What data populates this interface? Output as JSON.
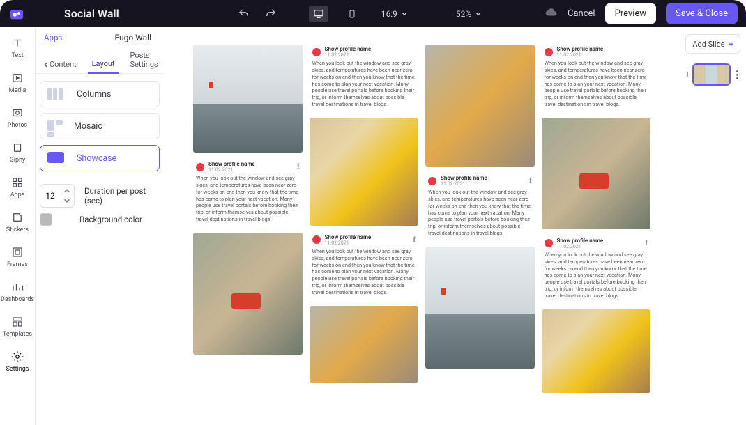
{
  "header": {
    "title": "Social Wall",
    "aspect": "16:9",
    "zoom": "52%",
    "cancel": "Cancel",
    "preview": "Preview",
    "save": "Save & Close"
  },
  "rail": {
    "items": [
      {
        "key": "text",
        "label": "Text"
      },
      {
        "key": "media",
        "label": "Media"
      },
      {
        "key": "photos",
        "label": "Photos"
      },
      {
        "key": "giphy",
        "label": "Giphy"
      },
      {
        "key": "apps",
        "label": "Apps"
      },
      {
        "key": "stickers",
        "label": "Stickers"
      },
      {
        "key": "frames",
        "label": "Frames"
      },
      {
        "key": "dashboards",
        "label": "Dashboards"
      },
      {
        "key": "templates",
        "label": "Templates"
      },
      {
        "key": "settings",
        "label": "Settings"
      }
    ]
  },
  "sidebar": {
    "apps_link": "Apps",
    "wall_name": "Fugo Wall",
    "tabs": {
      "content": "Content",
      "layout": "Layout",
      "posts": "Posts Settings"
    },
    "layout_options": {
      "columns": "Columns",
      "mosaic": "Mosaic",
      "showcase": "Showcase"
    },
    "duration_value": "12",
    "duration_label": "Duration per post (sec)",
    "bg_label": "Background color",
    "bg_color": "#b9b9b9"
  },
  "sample": {
    "profile": "Show profile name",
    "date": "11.02.2021",
    "caption": "When you look out the window and see gray skies, and temperatures have been near zero for weeks on end then you know that the time has come to plan your next vacation. Many people use travel portals before booking their trip, or inform themselves about possible travel destinations in travel blogs."
  },
  "right": {
    "add_slide": "Add Slide",
    "slide_number": "1"
  }
}
